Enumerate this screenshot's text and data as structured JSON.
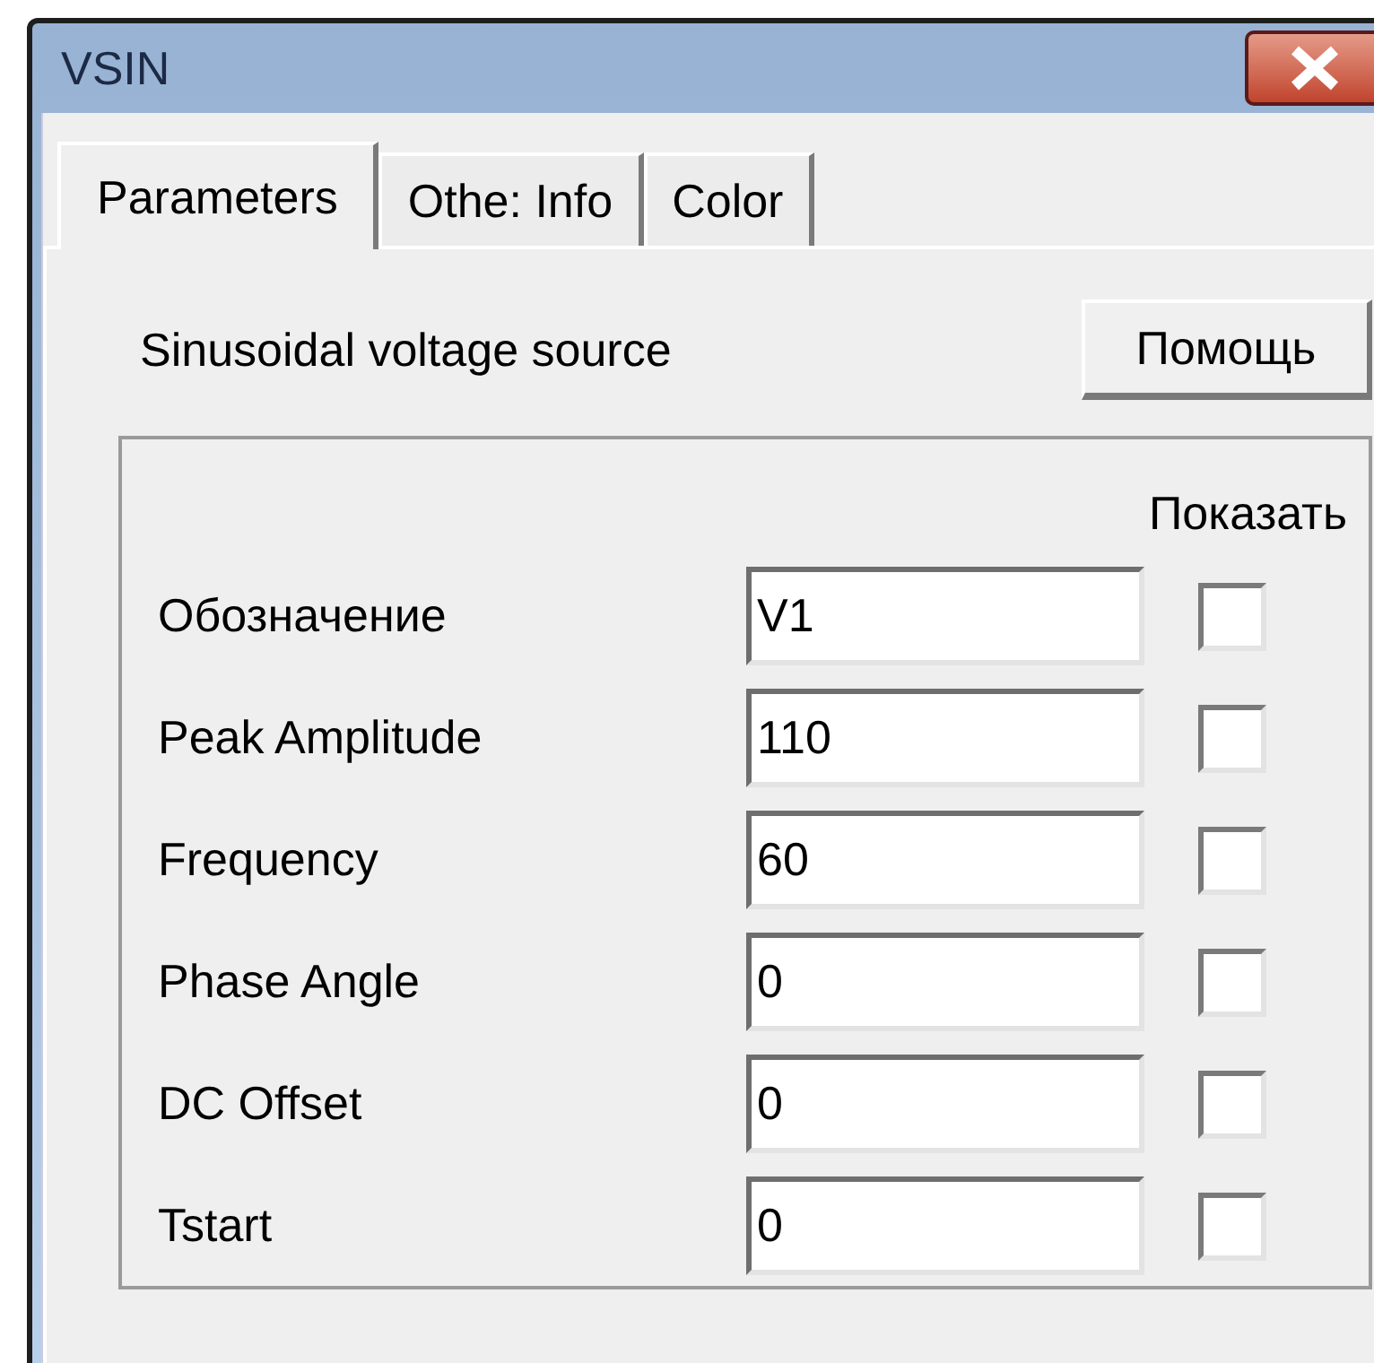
{
  "window": {
    "title": "VSIN"
  },
  "tabs": [
    {
      "label": "Parameters",
      "selected": true
    },
    {
      "label": "Othe: Info",
      "selected": false
    },
    {
      "label": "Color",
      "selected": false
    }
  ],
  "description": "Sinusoidal voltage source",
  "help_button": "Помощь",
  "show_header": "Показать",
  "parameters": [
    {
      "label": "Обозначение",
      "value": "V1",
      "checked": false
    },
    {
      "label": "Peak Amplitude",
      "value": "110",
      "checked": false
    },
    {
      "label": "Frequency",
      "value": "60",
      "checked": false
    },
    {
      "label": "Phase Angle",
      "value": "0",
      "checked": false
    },
    {
      "label": "DC Offset",
      "value": "0",
      "checked": false
    },
    {
      "label": "Tstart",
      "value": "0",
      "checked": false
    }
  ]
}
